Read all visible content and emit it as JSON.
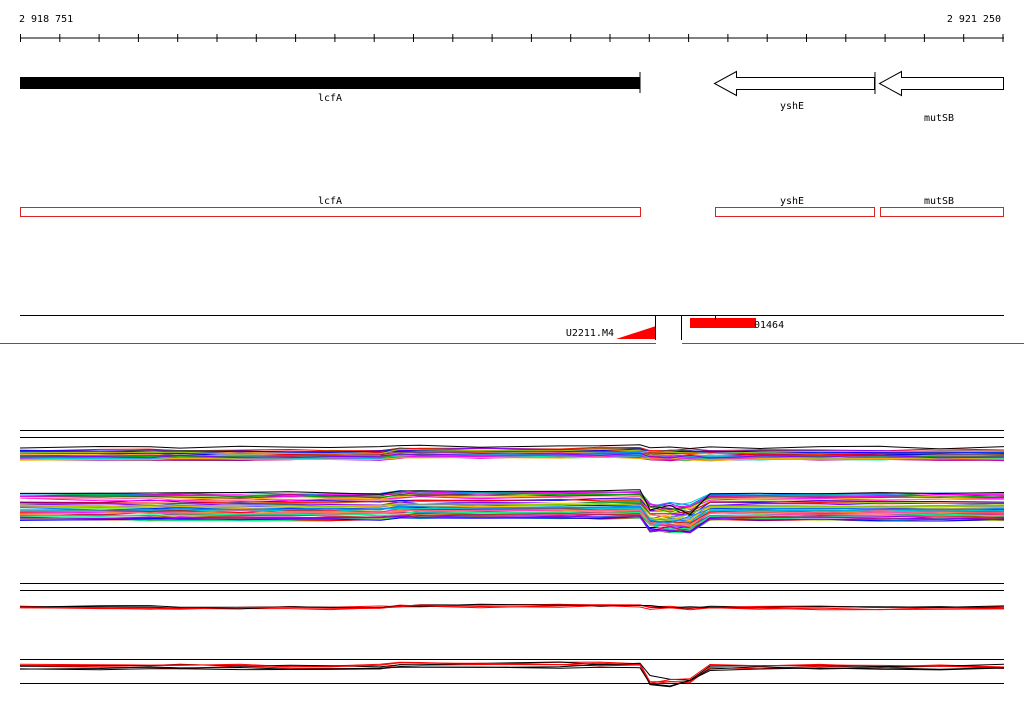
{
  "ruler": {
    "start_label": "2 918 751",
    "end_label": "2 921 250",
    "start": 2918751,
    "end": 2921250
  },
  "genes": [
    {
      "name": "lcfA",
      "strand": "+",
      "start": 2918751,
      "end": 2920328
    },
    {
      "name": "yshE",
      "strand": "-",
      "start": 2920518,
      "end": 2920915
    },
    {
      "name": "mutSB",
      "strand": "-",
      "start": 2920928,
      "end": 2921250
    }
  ],
  "features": [
    {
      "name": "U2211.M4",
      "color": "#ff0000"
    },
    {
      "name": "01464",
      "color": "#ff0000"
    }
  ],
  "colors": {
    "gene_fill": "#000000",
    "annotation_outline": "#dd2222",
    "feature": "#ff0000",
    "separator": "#dd2222"
  },
  "icons": {
    "plus_strand_gene": "solid-bar",
    "minus_strand_gene": "left-arrow-outline"
  }
}
